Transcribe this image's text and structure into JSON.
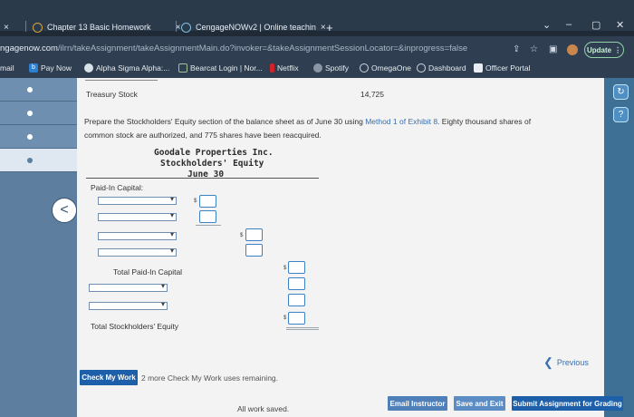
{
  "browser": {
    "tabs": [
      {
        "label": "Chapter 13 Basic Homework",
        "close": "×"
      },
      {
        "label": "CengageNOWv2 | Online teachin",
        "close": "×"
      }
    ],
    "new_tab": "+",
    "left_close": "×",
    "url_domain": "ngagenow.com",
    "url_path": "/ilrn/takeAssignment/takeAssignmentMain.do?invoker=&takeAssignmentSessionLocator=&inprogress=false",
    "update_label": "Update",
    "bookmarks": [
      "mail",
      "Pay Now",
      "Alpha Sigma Alpha:...",
      "Bearcat Login | Nor...",
      "Netflix",
      "Spotify",
      "OmegaOne",
      "Dashboard",
      "Officer Portal"
    ]
  },
  "page": {
    "treasury_label": "Treasury Stock",
    "treasury_value": "14,725",
    "instructions_1a": "Prepare the Stockholders' Equity section of the balance sheet as of June 30 using ",
    "instructions_link": "Method 1 of Exhibit 8",
    "instructions_1b": ". Eighty thousand shares of",
    "instructions_2": "common stock are authorized, and 775 shares have been reacquired.",
    "company_name": "Goodale Properties Inc.",
    "statement_name": "Stockholders' Equity",
    "statement_date": "June 30",
    "paid_in_label": "Paid-In Capital:",
    "total_paid_in_label": "Total Paid-In Capital",
    "total_equity_label": "Total Stockholders' Equity",
    "dollar_sign": "$",
    "check_my_work": "Check My Work",
    "check_remaining": "2 more Check My Work uses remaining.",
    "previous_label": "Previous",
    "saved_status": "All work saved.",
    "email_instructor": "Email Instructor",
    "save_exit": "Save and Exit",
    "submit": "Submit Assignment for Grading"
  },
  "colors": {
    "accent": "#1d5fa8",
    "footer_email": "#4f7fb8",
    "footer_save": "#5b8cc4",
    "footer_submit": "#1d5fa8"
  }
}
